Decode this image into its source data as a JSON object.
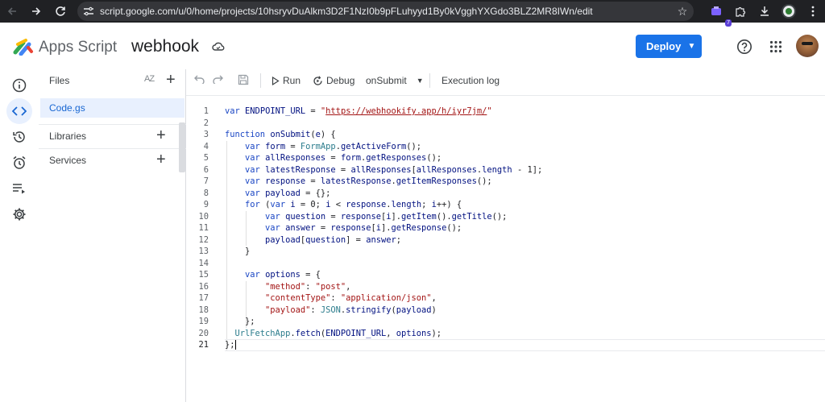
{
  "browser": {
    "url": "script.google.com/u/0/home/projects/10hsryvDuAlkm3D2F1NzI0b9pFLuhyyd1By0kVgghYXGdo3BLZ2MR8IWn/edit",
    "extension_badge": "7"
  },
  "header": {
    "app_name": "Apps Script",
    "project_name": "webhook",
    "deploy_label": "Deploy"
  },
  "files_panel": {
    "title": "Files",
    "sort_label": "AZ",
    "files": [
      "Code.gs"
    ],
    "libraries_label": "Libraries",
    "services_label": "Services"
  },
  "toolbar": {
    "run_label": "Run",
    "debug_label": "Debug",
    "function_select": "onSubmit",
    "execution_log_label": "Execution log"
  },
  "editor": {
    "line_numbers": [
      "1",
      "2",
      "3",
      "4",
      "5",
      "6",
      "7",
      "8",
      "9",
      "10",
      "11",
      "12",
      "13",
      "14",
      "15",
      "16",
      "17",
      "18",
      "19",
      "20",
      "21"
    ],
    "lines": [
      "var ENDPOINT_URL = \"https://webhookify.app/h/iyr7jm/\"",
      "",
      "function onSubmit(e) {",
      "    var form = FormApp.getActiveForm();",
      "    var allResponses = form.getResponses();",
      "    var latestResponse = allResponses[allResponses.length - 1];",
      "    var response = latestResponse.getItemResponses();",
      "    var payload = {};",
      "    for (var i = 0; i < response.length; i++) {",
      "        var question = response[i].getItem().getTitle();",
      "        var answer = response[i].getResponse();",
      "        payload[question] = answer;",
      "    }",
      "",
      "    var options = {",
      "        \"method\": \"post\",",
      "        \"contentType\": \"application/json\",",
      "        \"payload\": JSON.stringify(payload)",
      "    };",
      "  UrlFetchApp.fetch(ENDPOINT_URL, options);",
      "};"
    ],
    "current_line": 21
  }
}
